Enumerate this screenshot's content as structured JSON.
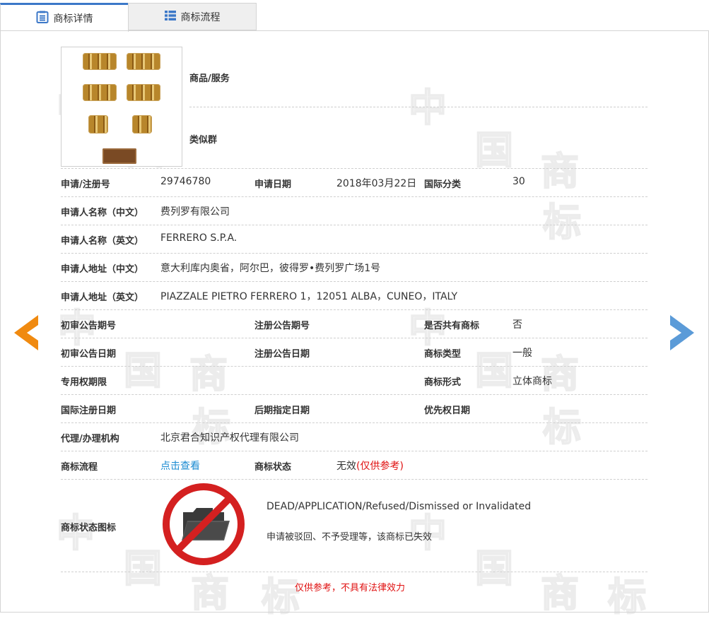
{
  "tabs": [
    {
      "label": "商标详情",
      "active": true
    },
    {
      "label": "商标流程",
      "active": false
    }
  ],
  "image_section": {
    "goods_services_label": "商品/服务",
    "similar_group_label": "类似群"
  },
  "fields": {
    "reg_no": {
      "label": "申请/注册号",
      "value": "29746780"
    },
    "app_date": {
      "label": "申请日期",
      "value": "2018年03月22日"
    },
    "intl_class": {
      "label": "国际分类",
      "value": "30"
    },
    "applicant_cn": {
      "label": "申请人名称（中文）",
      "value": "费列罗有限公司"
    },
    "applicant_en": {
      "label": "申请人名称（英文）",
      "value": "FERRERO S.P.A."
    },
    "address_cn": {
      "label": "申请人地址（中文）",
      "value": "意大利库内奥省，阿尔巴，彼得罗•费列罗广场1号"
    },
    "address_en": {
      "label": "申请人地址（英文）",
      "value": "PIAZZALE PIETRO FERRERO 1，12051 ALBA，CUNEO，ITALY"
    },
    "prelim_pub_no": {
      "label": "初审公告期号",
      "value": ""
    },
    "reg_pub_no": {
      "label": "注册公告期号",
      "value": ""
    },
    "shared": {
      "label": "是否共有商标",
      "value": "否"
    },
    "prelim_pub_date": {
      "label": "初审公告日期",
      "value": ""
    },
    "reg_pub_date": {
      "label": "注册公告日期",
      "value": ""
    },
    "tm_type": {
      "label": "商标类型",
      "value": "一般"
    },
    "exclusive_period": {
      "label": "专用权期限",
      "value": ""
    },
    "tm_form": {
      "label": "商标形式",
      "value": "立体商标"
    },
    "intl_reg_date": {
      "label": "国际注册日期",
      "value": ""
    },
    "later_designation": {
      "label": "后期指定日期",
      "value": ""
    },
    "priority_date": {
      "label": "优先权日期",
      "value": ""
    },
    "agent": {
      "label": "代理/办理机构",
      "value": "北京君合知识产权代理有限公司"
    },
    "process": {
      "label": "商标流程",
      "link": "点击查看"
    },
    "status": {
      "label": "商标状态",
      "value": "无效",
      "note": "(仅供参考)"
    },
    "status_icon": {
      "label": "商标状态图标",
      "en": "DEAD/APPLICATION/Refused/Dismissed or Invalidated",
      "cn": "申请被驳回、不予受理等，该商标已失效"
    }
  },
  "disclaimer": "仅供参考，不具有法律效力",
  "watermark": {
    "chars": [
      "中",
      "国",
      "商",
      "标"
    ]
  },
  "colors": {
    "accent": "#3c78c8",
    "prev_arrow": "#f08a10",
    "next_arrow": "#5b9bd8",
    "link": "#1a8bd2",
    "warn": "#e01010",
    "noentry": "#d42020"
  },
  "icons": [
    "detail-icon",
    "list-icon",
    "prev-arrow-icon",
    "next-arrow-icon",
    "folder-noentry-icon"
  ]
}
